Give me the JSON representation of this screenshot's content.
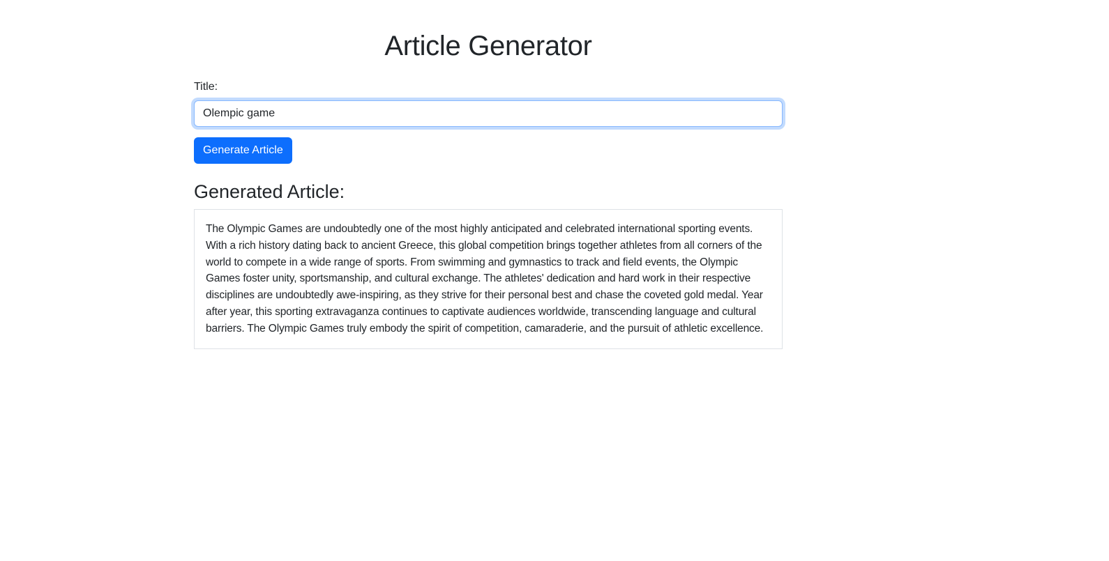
{
  "header": {
    "title": "Article Generator"
  },
  "form": {
    "title_label": "Title:",
    "title_value": "Olempic game",
    "generate_button": "Generate Article"
  },
  "result": {
    "heading": "Generated Article:",
    "article_text": "The Olympic Games are undoubtedly one of the most highly anticipated and celebrated international sporting events. With a rich history dating back to ancient Greece, this global competition brings together athletes from all corners of the world to compete in a wide range of sports. From swimming and gymnastics to track and field events, the Olympic Games foster unity, sportsmanship, and cultural exchange. The athletes' dedication and hard work in their respective disciplines are undoubtedly awe-inspiring, as they strive for their personal best and chase the coveted gold medal. Year after year, this sporting extravaganza continues to captivate audiences worldwide, transcending language and cultural barriers. The Olympic Games truly embody the spirit of competition, camaraderie, and the pursuit of athletic excellence."
  },
  "colors": {
    "accent": "#0d6efd",
    "text": "#212529",
    "border": "#dee2e6"
  }
}
